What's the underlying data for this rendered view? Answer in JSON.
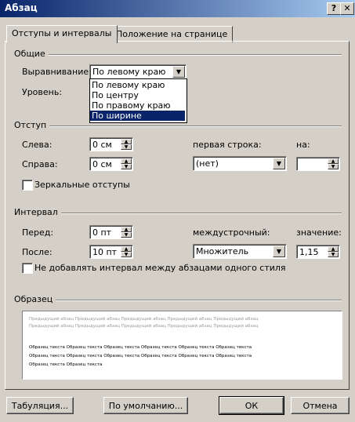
{
  "window": {
    "title": "Абзац",
    "help_label": "?",
    "close_label": "✕"
  },
  "tabs": [
    {
      "label": "Отступы и интервалы",
      "active": true
    },
    {
      "label": "Положение на странице",
      "active": false
    }
  ],
  "general": {
    "section_title": "Общие",
    "alignment_label": "Выравнивание:",
    "alignment_value": "По левому краю",
    "level_label": "Уровень:",
    "alignment_options": [
      "По левому краю",
      "По центру",
      "По правому краю",
      "По ширине"
    ],
    "highlighted_option": "По ширине"
  },
  "indent": {
    "section_title": "Отступ",
    "left_label": "Слева:",
    "left_value": "0 см",
    "right_label": "Справа:",
    "right_value": "0 см",
    "first_line_label": "первая строка:",
    "first_line_value": "(нет)",
    "on_label": "на:",
    "on_value": "",
    "mirror_label": "Зеркальные отступы",
    "mirror_checked": false
  },
  "spacing": {
    "section_title": "Интервал",
    "before_label": "Перед:",
    "before_value": "0 пт",
    "after_label": "После:",
    "after_value": "10 пт",
    "line_label": "междустрочный:",
    "line_value": "Множитель",
    "value_label": "значение:",
    "value_value": "1,15",
    "no_space_label": "Не добавлять интервал между абзацами одного стиля",
    "no_space_checked": false
  },
  "preview": {
    "section_title": "Образец",
    "prev_lines": [
      "Предыдущий абзац Предыдущий абзац Предыдущий абзац Предыдущий абзац Предыдущий абзац",
      "Предыдущий абзац Предыдущий абзац Предыдущий абзац Предыдущий абзац Предыдущий абзац"
    ],
    "cur_lines": [
      "Образец текста Образец текста Образец текста Образец текста Образец текста Образец текста",
      "Образец текста Образец текста Образец текста Образец текста Образец текста Образец текста",
      "Образец текста Образец текста"
    ]
  },
  "buttons": {
    "tabs": "Табуляция...",
    "default": "По умолчанию...",
    "ok": "ОК",
    "cancel": "Отмена"
  }
}
